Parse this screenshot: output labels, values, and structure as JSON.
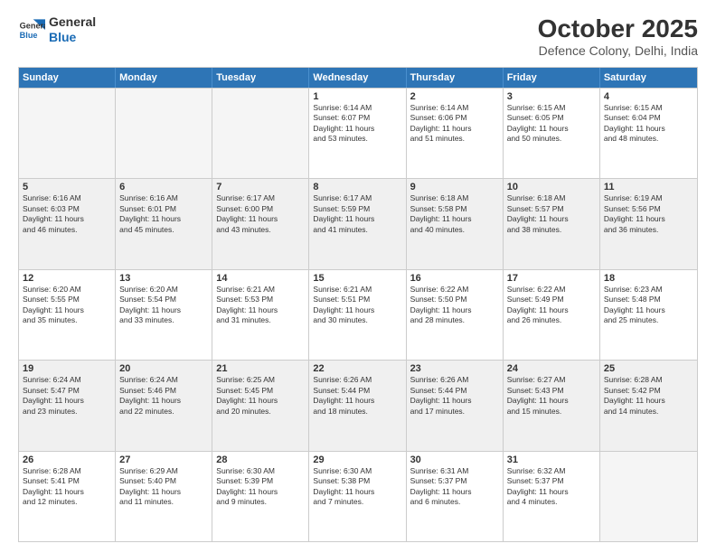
{
  "header": {
    "logo_line1": "General",
    "logo_line2": "Blue",
    "month": "October 2025",
    "location": "Defence Colony, Delhi, India"
  },
  "days_of_week": [
    "Sunday",
    "Monday",
    "Tuesday",
    "Wednesday",
    "Thursday",
    "Friday",
    "Saturday"
  ],
  "weeks": [
    [
      {
        "day": "",
        "text": "",
        "empty": true
      },
      {
        "day": "",
        "text": "",
        "empty": true
      },
      {
        "day": "",
        "text": "",
        "empty": true
      },
      {
        "day": "1",
        "text": "Sunrise: 6:14 AM\nSunset: 6:07 PM\nDaylight: 11 hours\nand 53 minutes."
      },
      {
        "day": "2",
        "text": "Sunrise: 6:14 AM\nSunset: 6:06 PM\nDaylight: 11 hours\nand 51 minutes."
      },
      {
        "day": "3",
        "text": "Sunrise: 6:15 AM\nSunset: 6:05 PM\nDaylight: 11 hours\nand 50 minutes."
      },
      {
        "day": "4",
        "text": "Sunrise: 6:15 AM\nSunset: 6:04 PM\nDaylight: 11 hours\nand 48 minutes."
      }
    ],
    [
      {
        "day": "5",
        "text": "Sunrise: 6:16 AM\nSunset: 6:03 PM\nDaylight: 11 hours\nand 46 minutes.",
        "shaded": true
      },
      {
        "day": "6",
        "text": "Sunrise: 6:16 AM\nSunset: 6:01 PM\nDaylight: 11 hours\nand 45 minutes.",
        "shaded": true
      },
      {
        "day": "7",
        "text": "Sunrise: 6:17 AM\nSunset: 6:00 PM\nDaylight: 11 hours\nand 43 minutes.",
        "shaded": true
      },
      {
        "day": "8",
        "text": "Sunrise: 6:17 AM\nSunset: 5:59 PM\nDaylight: 11 hours\nand 41 minutes.",
        "shaded": true
      },
      {
        "day": "9",
        "text": "Sunrise: 6:18 AM\nSunset: 5:58 PM\nDaylight: 11 hours\nand 40 minutes.",
        "shaded": true
      },
      {
        "day": "10",
        "text": "Sunrise: 6:18 AM\nSunset: 5:57 PM\nDaylight: 11 hours\nand 38 minutes.",
        "shaded": true
      },
      {
        "day": "11",
        "text": "Sunrise: 6:19 AM\nSunset: 5:56 PM\nDaylight: 11 hours\nand 36 minutes.",
        "shaded": true
      }
    ],
    [
      {
        "day": "12",
        "text": "Sunrise: 6:20 AM\nSunset: 5:55 PM\nDaylight: 11 hours\nand 35 minutes."
      },
      {
        "day": "13",
        "text": "Sunrise: 6:20 AM\nSunset: 5:54 PM\nDaylight: 11 hours\nand 33 minutes."
      },
      {
        "day": "14",
        "text": "Sunrise: 6:21 AM\nSunset: 5:53 PM\nDaylight: 11 hours\nand 31 minutes."
      },
      {
        "day": "15",
        "text": "Sunrise: 6:21 AM\nSunset: 5:51 PM\nDaylight: 11 hours\nand 30 minutes."
      },
      {
        "day": "16",
        "text": "Sunrise: 6:22 AM\nSunset: 5:50 PM\nDaylight: 11 hours\nand 28 minutes."
      },
      {
        "day": "17",
        "text": "Sunrise: 6:22 AM\nSunset: 5:49 PM\nDaylight: 11 hours\nand 26 minutes."
      },
      {
        "day": "18",
        "text": "Sunrise: 6:23 AM\nSunset: 5:48 PM\nDaylight: 11 hours\nand 25 minutes."
      }
    ],
    [
      {
        "day": "19",
        "text": "Sunrise: 6:24 AM\nSunset: 5:47 PM\nDaylight: 11 hours\nand 23 minutes.",
        "shaded": true
      },
      {
        "day": "20",
        "text": "Sunrise: 6:24 AM\nSunset: 5:46 PM\nDaylight: 11 hours\nand 22 minutes.",
        "shaded": true
      },
      {
        "day": "21",
        "text": "Sunrise: 6:25 AM\nSunset: 5:45 PM\nDaylight: 11 hours\nand 20 minutes.",
        "shaded": true
      },
      {
        "day": "22",
        "text": "Sunrise: 6:26 AM\nSunset: 5:44 PM\nDaylight: 11 hours\nand 18 minutes.",
        "shaded": true
      },
      {
        "day": "23",
        "text": "Sunrise: 6:26 AM\nSunset: 5:44 PM\nDaylight: 11 hours\nand 17 minutes.",
        "shaded": true
      },
      {
        "day": "24",
        "text": "Sunrise: 6:27 AM\nSunset: 5:43 PM\nDaylight: 11 hours\nand 15 minutes.",
        "shaded": true
      },
      {
        "day": "25",
        "text": "Sunrise: 6:28 AM\nSunset: 5:42 PM\nDaylight: 11 hours\nand 14 minutes.",
        "shaded": true
      }
    ],
    [
      {
        "day": "26",
        "text": "Sunrise: 6:28 AM\nSunset: 5:41 PM\nDaylight: 11 hours\nand 12 minutes."
      },
      {
        "day": "27",
        "text": "Sunrise: 6:29 AM\nSunset: 5:40 PM\nDaylight: 11 hours\nand 11 minutes."
      },
      {
        "day": "28",
        "text": "Sunrise: 6:30 AM\nSunset: 5:39 PM\nDaylight: 11 hours\nand 9 minutes."
      },
      {
        "day": "29",
        "text": "Sunrise: 6:30 AM\nSunset: 5:38 PM\nDaylight: 11 hours\nand 7 minutes."
      },
      {
        "day": "30",
        "text": "Sunrise: 6:31 AM\nSunset: 5:37 PM\nDaylight: 11 hours\nand 6 minutes."
      },
      {
        "day": "31",
        "text": "Sunrise: 6:32 AM\nSunset: 5:37 PM\nDaylight: 11 hours\nand 4 minutes."
      },
      {
        "day": "",
        "text": "",
        "empty": true
      }
    ]
  ]
}
